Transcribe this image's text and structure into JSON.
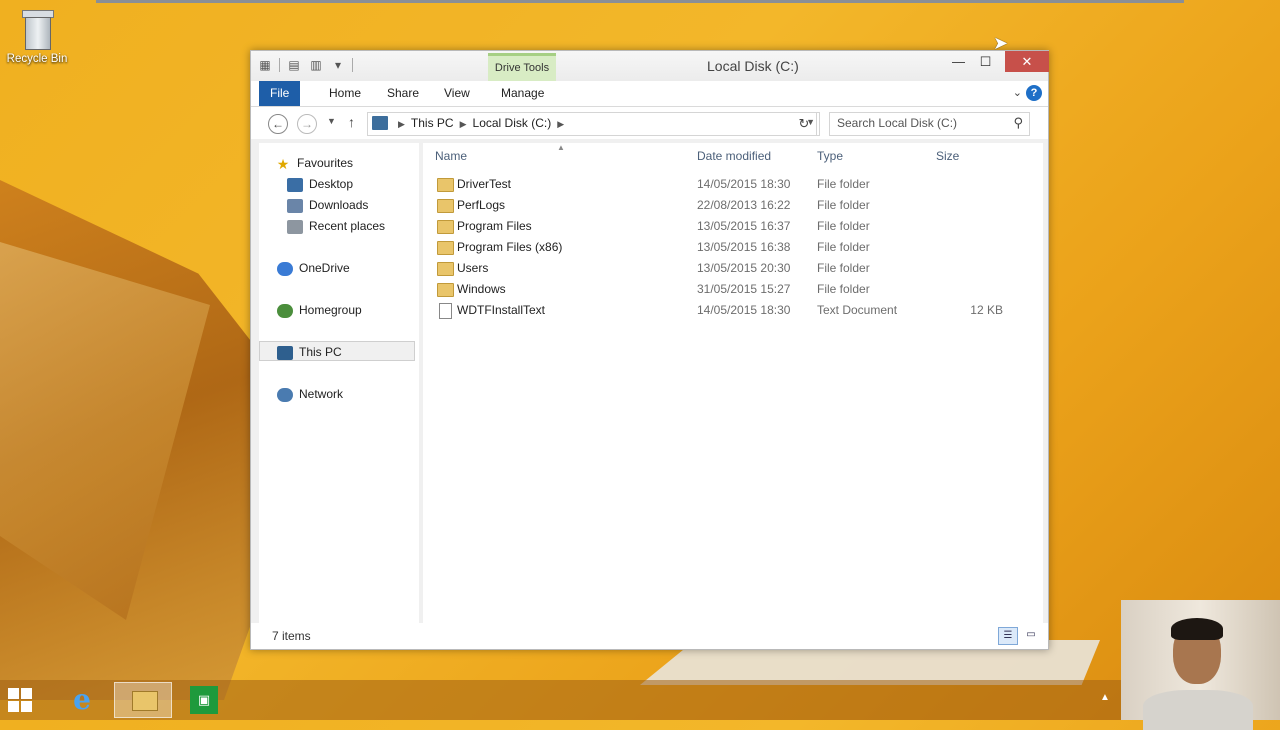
{
  "desktop": {
    "recycle_bin_label": "Recycle Bin"
  },
  "window": {
    "title": "Local Disk (C:)",
    "contextual_tab": "Drive Tools",
    "buttons": {
      "minimize": "—",
      "maximize": "☐",
      "close": "✕"
    }
  },
  "ribbon": {
    "tabs": [
      "File",
      "Home",
      "Share",
      "View",
      "Manage"
    ]
  },
  "address_bar": {
    "segments": [
      "This PC",
      "Local Disk (C:)"
    ],
    "search_placeholder": "Search Local Disk (C:)"
  },
  "nav_pane": {
    "favourites": "Favourites",
    "desktop": "Desktop",
    "downloads": "Downloads",
    "recent_places": "Recent places",
    "onedrive": "OneDrive",
    "homegroup": "Homegroup",
    "this_pc": "This PC",
    "network": "Network"
  },
  "columns": {
    "name": "Name",
    "date_modified": "Date modified",
    "type": "Type",
    "size": "Size"
  },
  "files": [
    {
      "name": "DriverTest",
      "date": "14/05/2015 18:30",
      "type": "File folder",
      "size": "",
      "icon": "folder-icon"
    },
    {
      "name": "PerfLogs",
      "date": "22/08/2013 16:22",
      "type": "File folder",
      "size": "",
      "icon": "folder-icon"
    },
    {
      "name": "Program Files",
      "date": "13/05/2015 16:37",
      "type": "File folder",
      "size": "",
      "icon": "folder-icon"
    },
    {
      "name": "Program Files (x86)",
      "date": "13/05/2015 16:38",
      "type": "File folder",
      "size": "",
      "icon": "folder-icon"
    },
    {
      "name": "Users",
      "date": "13/05/2015 20:30",
      "type": "File folder",
      "size": "",
      "icon": "folder-icon"
    },
    {
      "name": "Windows",
      "date": "31/05/2015 15:27",
      "type": "File folder",
      "size": "",
      "icon": "folder-icon"
    },
    {
      "name": "WDTFInstallText",
      "date": "14/05/2015 18:30",
      "type": "Text Document",
      "size": "12 KB",
      "icon": "document-icon"
    }
  ],
  "status": {
    "item_count": "7 items"
  },
  "colors": {
    "file_tab": "#1e5ea8",
    "close_button": "#c7504a",
    "drive_tools_tab": "#d8ecc4"
  }
}
